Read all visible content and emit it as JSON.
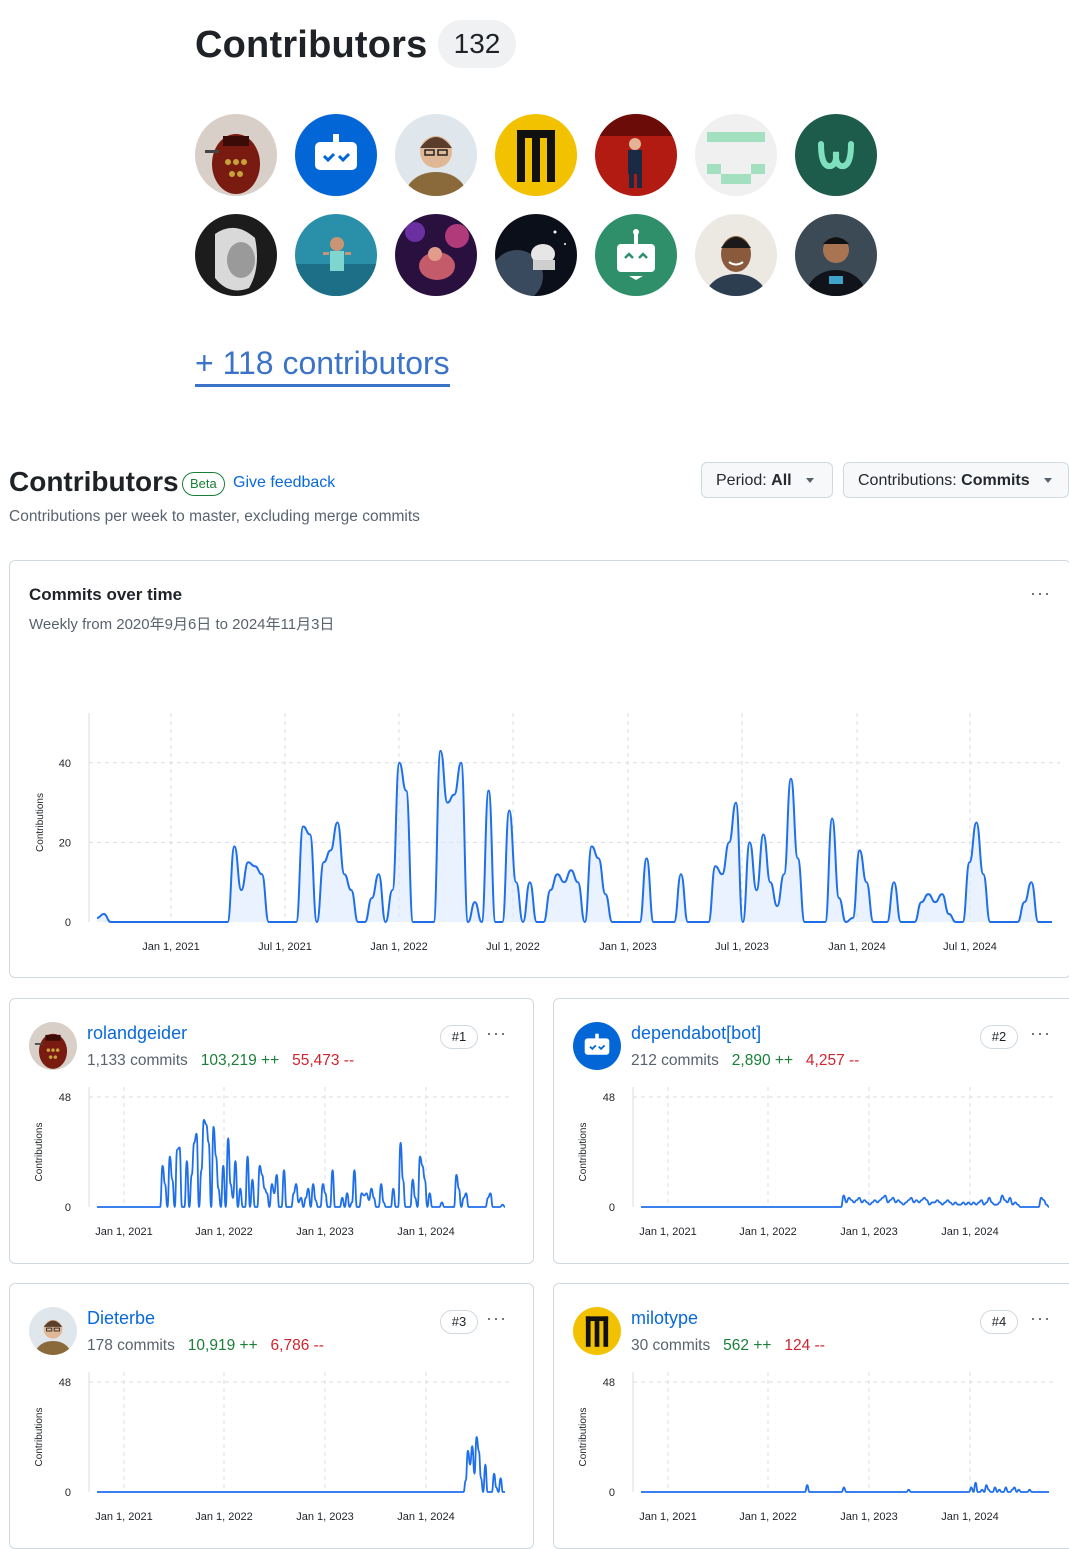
{
  "top_widget": {
    "title": "Contributors",
    "count": "132",
    "avatar_icons": [
      "avatar-dalek",
      "avatar-dependabot",
      "avatar-person-glasses",
      "avatar-yellow-logo",
      "avatar-red-stage",
      "avatar-green-pixel",
      "avatar-green-w",
      "avatar-bw-portrait",
      "avatar-person-water",
      "avatar-purple-concert",
      "avatar-space",
      "avatar-bot-green",
      "avatar-person-smiling",
      "avatar-person-night"
    ],
    "more_link": "+ 118 contributors"
  },
  "header": {
    "title": "Contributors",
    "beta": "Beta",
    "feedback": "Give feedback",
    "subtitle": "Contributions per week to master, excluding merge commits",
    "period_label": "Period:",
    "period_value": "All",
    "contrib_label": "Contributions:",
    "contrib_value": "Commits"
  },
  "main_chart": {
    "title": "Commits over time",
    "subtitle": "Weekly from 2020年9月6日 to 2024年11月3日",
    "menu": "···"
  },
  "colors": {
    "line": "#1f6feb",
    "fill": "#dbeafe",
    "add": "#1a7f37",
    "del": "#d1242f",
    "link": "#0969da"
  },
  "chart_data": [
    {
      "type": "area",
      "title": "Commits over time",
      "ylabel": "Contributions",
      "ylim": [
        0,
        52
      ],
      "yticks": [
        "40",
        "20",
        "0"
      ],
      "xticks": [
        "Jan 1, 2021",
        "Jul 1, 2021",
        "Jan 1, 2022",
        "Jul 1, 2022",
        "Jan 1, 2023",
        "Jul 1, 2023",
        "Jan 1, 2024",
        "Jul 1, 2024"
      ],
      "x_start": "2020-09-06",
      "x_step_days": 7,
      "values": [
        1,
        2,
        0,
        0,
        0,
        0,
        0,
        0,
        0,
        0,
        0,
        0,
        0,
        0,
        0,
        0,
        0,
        0,
        0,
        0,
        19,
        8,
        15,
        14,
        12,
        0,
        0,
        0,
        0,
        0,
        24,
        22,
        0,
        15,
        18,
        25,
        12,
        8,
        0,
        0,
        6,
        12,
        0,
        8,
        40,
        33,
        0,
        0,
        0,
        0,
        43,
        30,
        32,
        40,
        0,
        5,
        0,
        33,
        0,
        0,
        28,
        10,
        0,
        10,
        0,
        0,
        8,
        12,
        10,
        13,
        10,
        0,
        19,
        16,
        7,
        0,
        0,
        0,
        0,
        0,
        16,
        0,
        0,
        0,
        0,
        12,
        0,
        0,
        0,
        0,
        14,
        12,
        20,
        30,
        0,
        20,
        8,
        22,
        10,
        4,
        12,
        36,
        16,
        0,
        0,
        0,
        0,
        26,
        6,
        0,
        1,
        18,
        10,
        0,
        0,
        0,
        10,
        0,
        0,
        0,
        5,
        7,
        5,
        7,
        2,
        0,
        0,
        15,
        25,
        12,
        0,
        0,
        0,
        0,
        0,
        5,
        10,
        0,
        0,
        0
      ],
      "series": [
        {
          "name": "Commits",
          "values": "see values"
        }
      ]
    }
  ],
  "contributors": [
    {
      "name": "rolandgeider",
      "commits": "1,133 commits",
      "additions": "103,219 ++",
      "deletions": "55,473 --",
      "rank": "#1",
      "ylabel": "Contributions",
      "ymax_label": "48",
      "ymin_label": "0",
      "xticks": [
        "Jan 1, 2021",
        "Jan 1, 2022",
        "Jan 1, 2023",
        "Jan 1, 2024"
      ],
      "ylim": [
        0,
        48
      ],
      "values": [
        0,
        0,
        0,
        0,
        0,
        0,
        0,
        0,
        0,
        0,
        0,
        0,
        0,
        0,
        0,
        0,
        0,
        0,
        0,
        0,
        0,
        0,
        0,
        0,
        0,
        0,
        0,
        18,
        10,
        0,
        22,
        12,
        0,
        25,
        26,
        0,
        0,
        20,
        0,
        14,
        28,
        32,
        0,
        16,
        38,
        36,
        28,
        0,
        35,
        22,
        8,
        0,
        18,
        0,
        30,
        10,
        4,
        20,
        0,
        8,
        0,
        0,
        22,
        0,
        12,
        0,
        0,
        18,
        14,
        8,
        6,
        0,
        10,
        6,
        14,
        0,
        0,
        16,
        0,
        0,
        0,
        6,
        10,
        2,
        4,
        0,
        4,
        8,
        0,
        10,
        3,
        0,
        0,
        10,
        6,
        0,
        0,
        16,
        0,
        0,
        0,
        4,
        0,
        6,
        0,
        2,
        16,
        0,
        0,
        6,
        5,
        6,
        3,
        8,
        4,
        0,
        0,
        10,
        2,
        0,
        0,
        0,
        8,
        0,
        0,
        28,
        12,
        0,
        0,
        0,
        12,
        4,
        0,
        22,
        18,
        12,
        0,
        6,
        0,
        0,
        0,
        0,
        2,
        0,
        0,
        0,
        0,
        0,
        14,
        8,
        0,
        4,
        6,
        0,
        0,
        0,
        0,
        0,
        0,
        0,
        0,
        4,
        6,
        0,
        0,
        0,
        0,
        1,
        0
      ]
    },
    {
      "name": "dependabot[bot]",
      "commits": "212 commits",
      "additions": "2,890 ++",
      "deletions": "4,257 --",
      "rank": "#2",
      "ylabel": "Contributions",
      "ymax_label": "48",
      "ymin_label": "0",
      "xticks": [
        "Jan 1, 2021",
        "Jan 1, 2022",
        "Jan 1, 2023",
        "Jan 1, 2024"
      ],
      "ylim": [
        0,
        48
      ],
      "values": [
        0,
        0,
        0,
        0,
        0,
        0,
        0,
        0,
        0,
        0,
        0,
        0,
        0,
        0,
        0,
        0,
        0,
        0,
        0,
        0,
        0,
        0,
        0,
        0,
        0,
        0,
        0,
        0,
        0,
        0,
        0,
        0,
        0,
        0,
        0,
        0,
        0,
        0,
        0,
        0,
        0,
        0,
        0,
        0,
        0,
        0,
        0,
        0,
        0,
        0,
        0,
        0,
        0,
        0,
        0,
        0,
        0,
        0,
        0,
        0,
        0,
        0,
        0,
        0,
        0,
        0,
        0,
        0,
        0,
        0,
        0,
        0,
        0,
        0,
        0,
        0,
        0,
        0,
        5,
        2,
        4,
        3,
        2,
        3,
        4,
        2,
        3,
        2,
        1,
        2,
        3,
        2,
        3,
        4,
        5,
        2,
        3,
        4,
        2,
        3,
        2,
        1,
        2,
        3,
        4,
        2,
        3,
        2,
        3,
        4,
        3,
        1,
        2,
        2,
        3,
        2,
        1,
        2,
        3,
        2,
        1,
        2,
        1,
        1,
        2,
        1,
        2,
        1,
        2,
        1,
        2,
        3,
        1,
        2,
        4,
        2,
        1,
        1,
        2,
        5,
        3,
        2,
        4,
        1,
        2,
        1,
        0,
        0,
        0,
        0,
        0,
        0,
        0,
        0,
        4,
        3,
        1,
        0
      ]
    },
    {
      "name": "Dieterbe",
      "commits": "178 commits",
      "additions": "10,919 ++",
      "deletions": "6,786 --",
      "rank": "#3",
      "ylabel": "Contributions",
      "ymax_label": "48",
      "ymin_label": "0",
      "xticks": [
        "Jan 1, 2021",
        "Jan 1, 2022",
        "Jan 1, 2023",
        "Jan 1, 2024"
      ],
      "ylim": [
        0,
        48
      ],
      "values": [
        0,
        0,
        0,
        0,
        0,
        0,
        0,
        0,
        0,
        0,
        0,
        0,
        0,
        0,
        0,
        0,
        0,
        0,
        0,
        0,
        0,
        0,
        0,
        0,
        0,
        0,
        0,
        0,
        0,
        0,
        0,
        0,
        0,
        0,
        0,
        0,
        0,
        0,
        0,
        0,
        0,
        0,
        0,
        0,
        0,
        0,
        0,
        0,
        0,
        0,
        0,
        0,
        0,
        0,
        0,
        0,
        0,
        0,
        0,
        0,
        0,
        0,
        0,
        0,
        0,
        0,
        0,
        0,
        0,
        0,
        0,
        0,
        0,
        0,
        0,
        0,
        0,
        0,
        0,
        0,
        0,
        0,
        0,
        0,
        0,
        0,
        0,
        0,
        0,
        0,
        0,
        0,
        0,
        0,
        0,
        0,
        0,
        0,
        0,
        0,
        0,
        0,
        0,
        0,
        0,
        0,
        0,
        0,
        0,
        0,
        0,
        0,
        0,
        0,
        0,
        0,
        0,
        0,
        0,
        0,
        0,
        0,
        0,
        0,
        0,
        0,
        0,
        0,
        0,
        0,
        0,
        0,
        0,
        0,
        0,
        0,
        0,
        0,
        0,
        0,
        0,
        0,
        0,
        0,
        0,
        0,
        0,
        0,
        0,
        0,
        0,
        0,
        0,
        0,
        0,
        0,
        0,
        0,
        0,
        0,
        0,
        0,
        0,
        0,
        0,
        0,
        0,
        0,
        0,
        5,
        18,
        12,
        20,
        8,
        24,
        18,
        6,
        0,
        12,
        0,
        0,
        0,
        8,
        2,
        0,
        6,
        0,
        0
      ]
    },
    {
      "name": "milotype",
      "commits": "30 commits",
      "additions": "562 ++",
      "deletions": "124 --",
      "rank": "#4",
      "ylabel": "Contributions",
      "ymax_label": "48",
      "ymin_label": "0",
      "xticks": [
        "Jan 1, 2021",
        "Jan 1, 2022",
        "Jan 1, 2023",
        "Jan 1, 2024"
      ],
      "ylim": [
        0,
        48
      ],
      "values": [
        0,
        0,
        0,
        0,
        0,
        0,
        0,
        0,
        0,
        0,
        0,
        0,
        0,
        0,
        0,
        0,
        0,
        0,
        0,
        0,
        0,
        0,
        0,
        0,
        0,
        0,
        0,
        0,
        0,
        0,
        0,
        0,
        0,
        0,
        0,
        0,
        0,
        0,
        0,
        0,
        0,
        0,
        0,
        0,
        0,
        0,
        0,
        0,
        0,
        0,
        0,
        0,
        0,
        0,
        0,
        0,
        0,
        0,
        0,
        0,
        0,
        0,
        0,
        0,
        0,
        0,
        0,
        0,
        0,
        0,
        0,
        0,
        0,
        0,
        0,
        0,
        0,
        3,
        0,
        0,
        0,
        0,
        0,
        0,
        0,
        0,
        0,
        0,
        0,
        0,
        0,
        0,
        0,
        0,
        2,
        0,
        0,
        0,
        0,
        0,
        0,
        0,
        0,
        0,
        0,
        0,
        0,
        0,
        0,
        0,
        0,
        0,
        0,
        0,
        0,
        0,
        0,
        0,
        0,
        0,
        0,
        0,
        0,
        0,
        1,
        0,
        0,
        0,
        0,
        0,
        0,
        0,
        0,
        0,
        0,
        0,
        0,
        0,
        0,
        0,
        0,
        0,
        0,
        0,
        0,
        0,
        0,
        0,
        0,
        0,
        0,
        0,
        0,
        2,
        0,
        4,
        0,
        0,
        1,
        0,
        3,
        1,
        0,
        0,
        2,
        0,
        1,
        0,
        0,
        2,
        0,
        0,
        1,
        2,
        0,
        1,
        0,
        0,
        0,
        0,
        1,
        0,
        0,
        0,
        0,
        0,
        0,
        0,
        0,
        0
      ]
    }
  ]
}
